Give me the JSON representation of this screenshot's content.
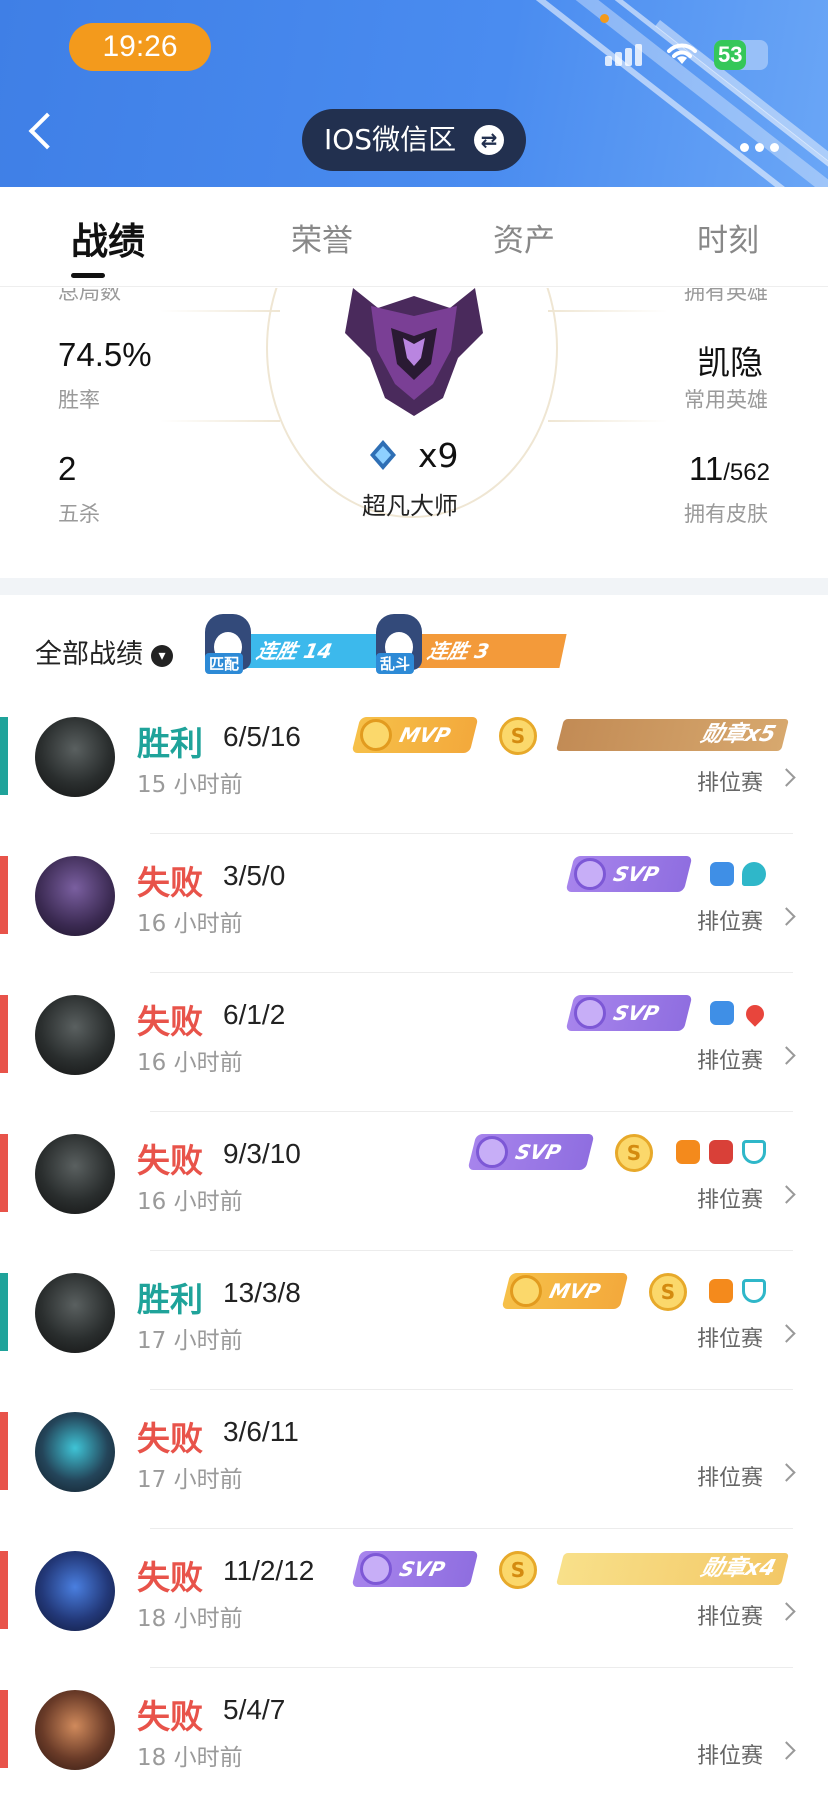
{
  "status_bar": {
    "time": "19:26",
    "battery": "53"
  },
  "header": {
    "region": "IOS微信区",
    "swap_icon": "⇄"
  },
  "tabs": [
    {
      "label": "战绩",
      "active": true
    },
    {
      "label": "荣誉",
      "active": false
    },
    {
      "label": "资产",
      "active": false
    },
    {
      "label": "时刻",
      "active": false
    }
  ],
  "summary": {
    "top_left_label_cut": "总局数",
    "top_right_label_cut": "拥有英雄",
    "win_rate": "74.5%",
    "win_rate_label": "胜率",
    "penta": "2",
    "penta_label": "五杀",
    "fav_hero": "凯隐",
    "fav_hero_label": "常用英雄",
    "skins_owned": "11",
    "skins_total": "/562",
    "skins_label": "拥有皮肤",
    "rank_stars": "x9",
    "rank_name": "超凡大师"
  },
  "records": {
    "title": "全部战绩",
    "streaks": [
      {
        "tag": "匹配",
        "label": "连胜 14",
        "color": "#3cb9ec"
      },
      {
        "tag": "乱斗",
        "label": "连胜 3",
        "color": "#f39a3a"
      }
    ]
  },
  "matches": [
    {
      "result": "胜利",
      "win": true,
      "kda": "6/5/16",
      "ago": "15 小时前",
      "mode": "排位赛",
      "badge": "MVP",
      "badge_type": "gold",
      "coin": "S",
      "medal_text": "勋章x5",
      "medal_style": "brown"
    },
    {
      "result": "失败",
      "win": false,
      "kda": "3/5/0",
      "ago": "16 小时前",
      "mode": "排位赛",
      "badge": "SVP",
      "badge_type": "purple"
    },
    {
      "result": "失败",
      "win": false,
      "kda": "6/1/2",
      "ago": "16 小时前",
      "mode": "排位赛",
      "badge": "SVP",
      "badge_type": "purple"
    },
    {
      "result": "失败",
      "win": false,
      "kda": "9/3/10",
      "ago": "16 小时前",
      "mode": "排位赛",
      "badge": "SVP",
      "badge_type": "purple",
      "coin": "S"
    },
    {
      "result": "胜利",
      "win": true,
      "kda": "13/3/8",
      "ago": "17 小时前",
      "mode": "排位赛",
      "badge": "MVP",
      "badge_type": "gold",
      "coin": "S"
    },
    {
      "result": "失败",
      "win": false,
      "kda": "3/6/11",
      "ago": "17 小时前",
      "mode": "排位赛"
    },
    {
      "result": "失败",
      "win": false,
      "kda": "11/2/12",
      "ago": "18 小时前",
      "mode": "排位赛",
      "badge": "SVP",
      "badge_type": "purple",
      "coin": "S",
      "medal_text": "勋章x4",
      "medal_style": "yellow"
    },
    {
      "result": "失败",
      "win": false,
      "kda": "5/4/7",
      "ago": "18 小时前",
      "mode": "排位赛"
    }
  ],
  "colors": {
    "win": "#1fa39a",
    "lose": "#e8534a",
    "header_blue": "#4a8cf0",
    "time_pill": "#f39a1c"
  }
}
